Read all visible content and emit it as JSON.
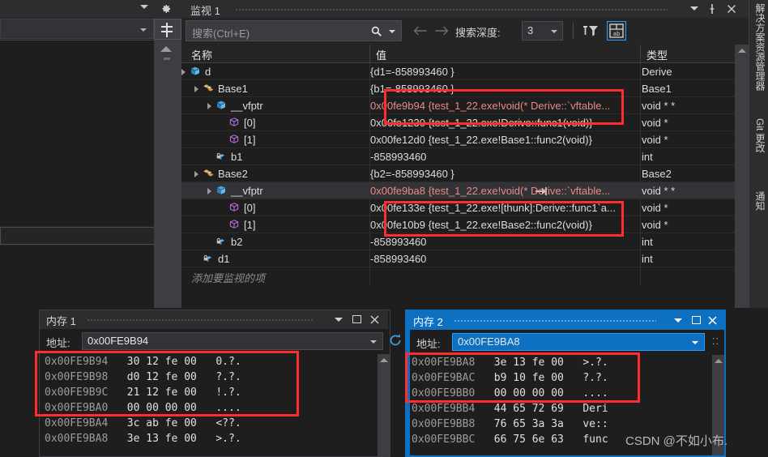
{
  "left_panel": {
    "gear_icon": "gear-icon",
    "dropdown_caret": "chevron-down-icon",
    "split_icon": "horizontal-split-icon"
  },
  "watch_window": {
    "title": "监视 1",
    "caret_icon": "chevron-down-icon",
    "pin_icon": "pin-icon",
    "close_icon": "close-icon",
    "toolbar": {
      "search_placeholder": "搜索(Ctrl+E)",
      "search_icon": "search-icon",
      "search_dropdown_icon": "chevron-down-icon",
      "back_icon": "arrow-left-icon",
      "forward_icon": "arrow-right-icon",
      "depth_label": "搜索深度:",
      "depth_value": "3",
      "depth_caret_icon": "chevron-down-icon",
      "filter_icon": "filter-pin-icon",
      "hex_icon": "hexadecimal-display-icon"
    },
    "columns": [
      "名称",
      "值",
      "类型"
    ],
    "add_item_placeholder": "添加要监视的项",
    "rows": [
      {
        "indent": 10,
        "expander": true,
        "icon": "cube-blue-icon",
        "name": "d",
        "value": "{d1=-858993460 }",
        "type": "Derive",
        "value_red": false,
        "selected": false,
        "pin": false
      },
      {
        "indent": 26,
        "expander": true,
        "icon": "puzzle-orange-icon",
        "name": "Base1",
        "value": "{b1=-858993460 }",
        "type": "Base1",
        "value_red": false,
        "selected": false,
        "pin": false
      },
      {
        "indent": 42,
        "expander": true,
        "icon": "cube-blue-icon",
        "name": "__vfptr",
        "value": "0x00fe9b94 {test_1_22.exe!void(* Derive::`vftable...",
        "type": "void * *",
        "value_red": true,
        "selected": false,
        "pin": false
      },
      {
        "indent": 58,
        "expander": false,
        "icon": "cube-purple-icon",
        "name": "[0]",
        "value": "0x00fe1230 {test_1_22.exe!Derive::func1(void)}",
        "type": "void *",
        "value_red": false,
        "selected": false,
        "pin": false
      },
      {
        "indent": 58,
        "expander": false,
        "icon": "cube-purple-icon",
        "name": "[1]",
        "value": "0x00fe12d0 {test_1_22.exe!Base1::func2(void)}",
        "type": "void *",
        "value_red": false,
        "selected": false,
        "pin": false
      },
      {
        "indent": 42,
        "expander": false,
        "icon": "field-lock-icon",
        "name": "b1",
        "value": "-858993460",
        "type": "int",
        "value_red": false,
        "selected": false,
        "pin": false
      },
      {
        "indent": 26,
        "expander": true,
        "icon": "puzzle-orange-icon",
        "name": "Base2",
        "value": "{b2=-858993460 }",
        "type": "Base2",
        "value_red": false,
        "selected": false,
        "pin": false
      },
      {
        "indent": 42,
        "expander": true,
        "icon": "cube-blue-icon",
        "name": "__vfptr",
        "value": "0x00fe9ba8 {test_1_22.exe!void(* Derive::`vftable...",
        "type": "void * *",
        "value_red": true,
        "selected": true,
        "pin": true
      },
      {
        "indent": 58,
        "expander": false,
        "icon": "cube-purple-icon",
        "name": "[0]",
        "value": "0x00fe133e {test_1_22.exe![thunk]:Derive::func1`a...",
        "type": "void *",
        "value_red": false,
        "selected": false,
        "pin": false
      },
      {
        "indent": 58,
        "expander": false,
        "icon": "cube-purple-icon",
        "name": "[1]",
        "value": "0x00fe10b9 {test_1_22.exe!Base2::func2(void)}",
        "type": "void *",
        "value_red": false,
        "selected": false,
        "pin": false
      },
      {
        "indent": 42,
        "expander": false,
        "icon": "field-lock-icon",
        "name": "b2",
        "value": "-858993460",
        "type": "int",
        "value_red": false,
        "selected": false,
        "pin": false
      },
      {
        "indent": 26,
        "expander": false,
        "icon": "field-lock-icon",
        "name": "d1",
        "value": "-858993460",
        "type": "int",
        "value_red": false,
        "selected": false,
        "pin": false
      }
    ]
  },
  "vertical_tabs": [
    {
      "label": "解决方案资源管理器"
    },
    {
      "label": "Git 更改"
    },
    {
      "label": "通知"
    }
  ],
  "memory1": {
    "title": "内存 1",
    "caret_icon": "chevron-down-icon",
    "maximize_icon": "maximize-icon",
    "close_icon": "close-icon",
    "address_label": "地址:",
    "address_value": "0x00FE9B94",
    "address_caret_icon": "chevron-down-icon",
    "refresh_icon": "refresh-icon",
    "overflow_icon": "chevron-double-right-icon",
    "rows": [
      {
        "addr": "0x00FE9B94",
        "hex": "30 12 fe 00",
        "ascii": "0.?."
      },
      {
        "addr": "0x00FE9B98",
        "hex": "d0 12 fe 00",
        "ascii": "?.?."
      },
      {
        "addr": "0x00FE9B9C",
        "hex": "21 12 fe 00",
        "ascii": "!.?."
      },
      {
        "addr": "0x00FE9BA0",
        "hex": "00 00 00 00",
        "ascii": "...."
      },
      {
        "addr": "0x00FE9BA4",
        "hex": "3c ab fe 00",
        "ascii": "<??."
      },
      {
        "addr": "0x00FE9BA8",
        "hex": "3e 13 fe 00",
        "ascii": ">.?."
      }
    ]
  },
  "memory2": {
    "title": "内存 2",
    "caret_icon": "chevron-down-icon",
    "maximize_icon": "maximize-icon",
    "close_icon": "close-icon",
    "address_label": "地址:",
    "address_value": "0x00FE9BA8",
    "address_caret_icon": "chevron-down-icon",
    "overflow_icon": "chevron-double-right-icon",
    "rows": [
      {
        "addr": "0x00FE9BA8",
        "hex": "3e 13 fe 00",
        "ascii": ">.?."
      },
      {
        "addr": "0x00FE9BAC",
        "hex": "b9 10 fe 00",
        "ascii": "?.?."
      },
      {
        "addr": "0x00FE9BB0",
        "hex": "00 00 00 00",
        "ascii": "...."
      },
      {
        "addr": "0x00FE9BB4",
        "hex": "44 65 72 69",
        "ascii": "Deri"
      },
      {
        "addr": "0x00FE9BB8",
        "hex": "76 65 3a 3a",
        "ascii": "ve::"
      },
      {
        "addr": "0x00FE9BBC",
        "hex": "66 75 6e 63",
        "ascii": "func"
      }
    ]
  },
  "watermark": "CSDN @不如小布.",
  "colors": {
    "accent_blue": "#0e70c0",
    "highlight_red": "#ff2d2d",
    "value_red_text": "#e78a8a",
    "background": "#1e1e1e"
  }
}
